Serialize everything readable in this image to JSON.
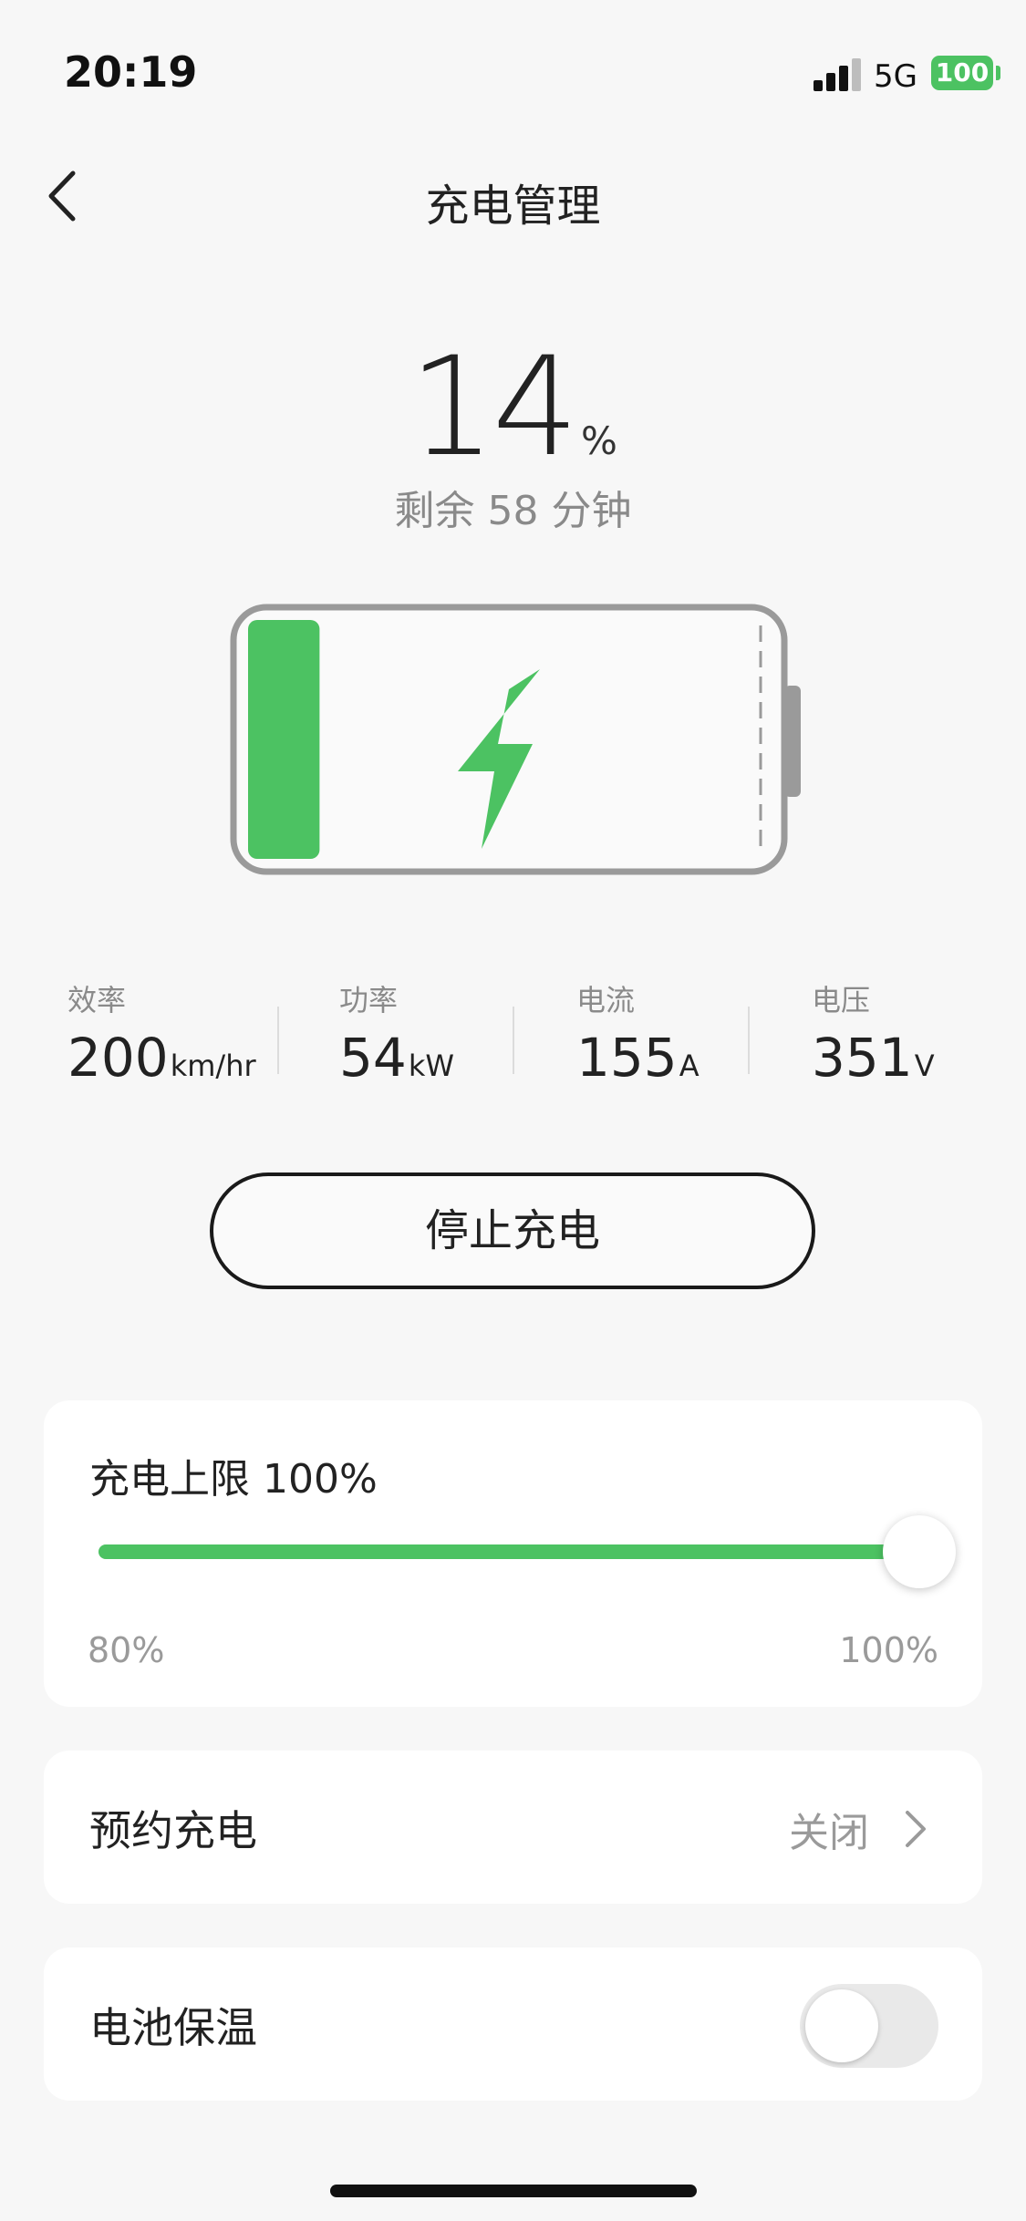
{
  "status_bar": {
    "time": "20:19",
    "network": "5G",
    "battery": "100",
    "battery_color": "#4cc262"
  },
  "nav": {
    "title": "充电管理",
    "back_icon": "chevron-left-icon"
  },
  "charge": {
    "percent": "14",
    "percent_unit": "%",
    "percent_fraction": 0.14,
    "remaining": "剩余 58 分钟",
    "accent_color": "#4cc262",
    "bolt_icon": "lightning-bolt-icon"
  },
  "stats": [
    {
      "label": "效率",
      "value": "200",
      "unit": "km/hr"
    },
    {
      "label": "功率",
      "value": "54",
      "unit": "kW"
    },
    {
      "label": "电流",
      "value": "155",
      "unit": "A"
    },
    {
      "label": "电压",
      "value": "351",
      "unit": "V"
    }
  ],
  "stop_button": {
    "label": "停止充电"
  },
  "charge_limit": {
    "label": "充电上限 100%",
    "min_label": "80%",
    "max_label": "100%",
    "min": 80,
    "max": 100,
    "value": 100
  },
  "schedule": {
    "label": "预约充电",
    "value": "关闭",
    "icon": "chevron-right-icon"
  },
  "battery_warm": {
    "label": "电池保温",
    "enabled": false
  }
}
